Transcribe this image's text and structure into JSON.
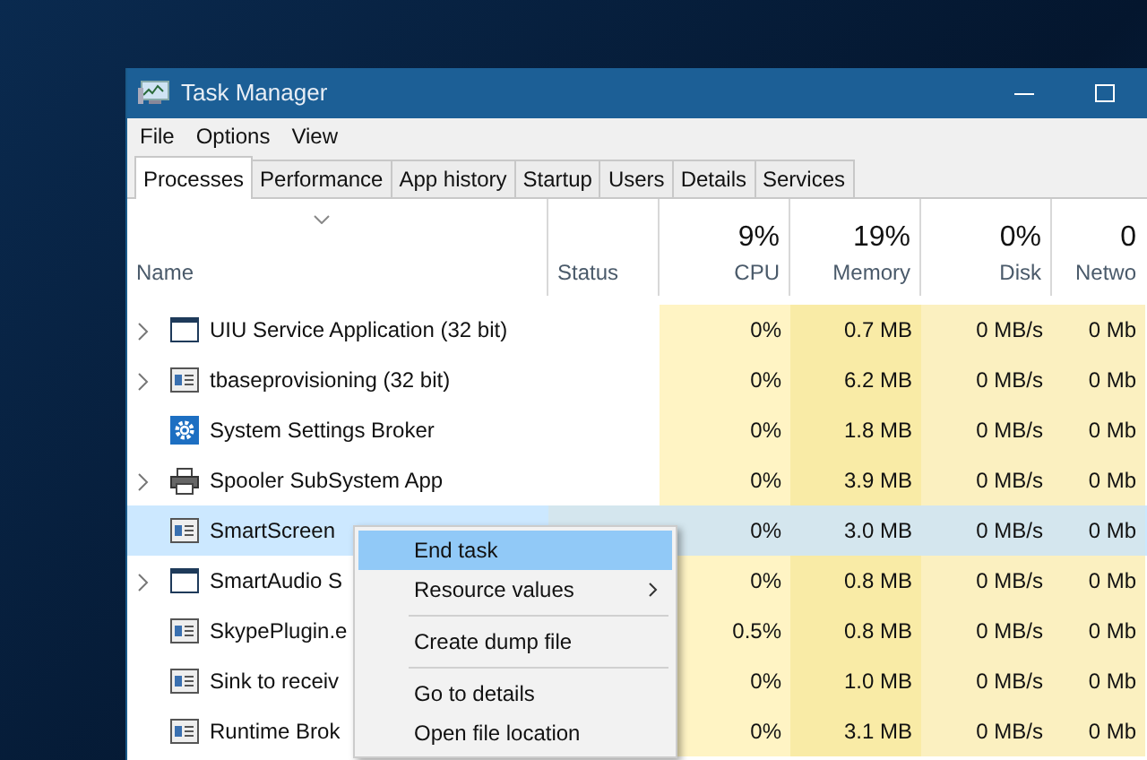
{
  "window": {
    "title": "Task Manager"
  },
  "menu": [
    "File",
    "Options",
    "View"
  ],
  "tabs": [
    {
      "label": "Processes",
      "selected": true
    },
    {
      "label": "Performance",
      "selected": false
    },
    {
      "label": "App history",
      "selected": false
    },
    {
      "label": "Startup",
      "selected": false
    },
    {
      "label": "Users",
      "selected": false
    },
    {
      "label": "Details",
      "selected": false
    },
    {
      "label": "Services",
      "selected": false
    }
  ],
  "columns": {
    "name": "Name",
    "status": "Status",
    "metrics": [
      {
        "summary": "9%",
        "label": "CPU"
      },
      {
        "summary": "19%",
        "label": "Memory"
      },
      {
        "summary": "0%",
        "label": "Disk"
      },
      {
        "summary": "0",
        "label": "Netwo"
      }
    ]
  },
  "rows": [
    {
      "name": "UIU Service Application (32 bit)",
      "expandable": true,
      "kind": "window",
      "selected": false,
      "values": [
        "0%",
        "0.7 MB",
        "0 MB/s",
        "0 Mb"
      ]
    },
    {
      "name": "tbaseprovisioning (32 bit)",
      "expandable": true,
      "kind": "app",
      "selected": false,
      "values": [
        "0%",
        "6.2 MB",
        "0 MB/s",
        "0 Mb"
      ]
    },
    {
      "name": "System Settings Broker",
      "expandable": false,
      "kind": "gear",
      "selected": false,
      "values": [
        "0%",
        "1.8 MB",
        "0 MB/s",
        "0 Mb"
      ]
    },
    {
      "name": "Spooler SubSystem App",
      "expandable": true,
      "kind": "printer",
      "selected": false,
      "values": [
        "0%",
        "3.9 MB",
        "0 MB/s",
        "0 Mb"
      ]
    },
    {
      "name": "SmartScreen",
      "expandable": false,
      "kind": "app",
      "selected": true,
      "values": [
        "0%",
        "3.0 MB",
        "0 MB/s",
        "0 Mb"
      ]
    },
    {
      "name": "SmartAudio S",
      "expandable": true,
      "kind": "window",
      "selected": false,
      "values": [
        "0%",
        "0.8 MB",
        "0 MB/s",
        "0 Mb"
      ]
    },
    {
      "name": "SkypePlugin.e",
      "expandable": false,
      "kind": "app",
      "selected": false,
      "values": [
        "0.5%",
        "0.8 MB",
        "0 MB/s",
        "0 Mb"
      ]
    },
    {
      "name": "Sink to receiv",
      "expandable": false,
      "kind": "app",
      "selected": false,
      "values": [
        "0%",
        "1.0 MB",
        "0 MB/s",
        "0 Mb"
      ]
    },
    {
      "name": "Runtime Brok",
      "expandable": false,
      "kind": "app",
      "selected": false,
      "values": [
        "0%",
        "3.1 MB",
        "0 MB/s",
        "0 Mb"
      ]
    }
  ],
  "context_menu": {
    "items": [
      {
        "kind": "item",
        "label": "End task",
        "highlighted": true,
        "submenu": false
      },
      {
        "kind": "item",
        "label": "Resource values",
        "highlighted": false,
        "submenu": true
      },
      {
        "kind": "separator"
      },
      {
        "kind": "item",
        "label": "Create dump file",
        "highlighted": false,
        "submenu": false
      },
      {
        "kind": "separator"
      },
      {
        "kind": "item",
        "label": "Go to details",
        "highlighted": false,
        "submenu": false
      },
      {
        "kind": "item",
        "label": "Open file location",
        "highlighted": false,
        "submenu": false
      }
    ]
  }
}
